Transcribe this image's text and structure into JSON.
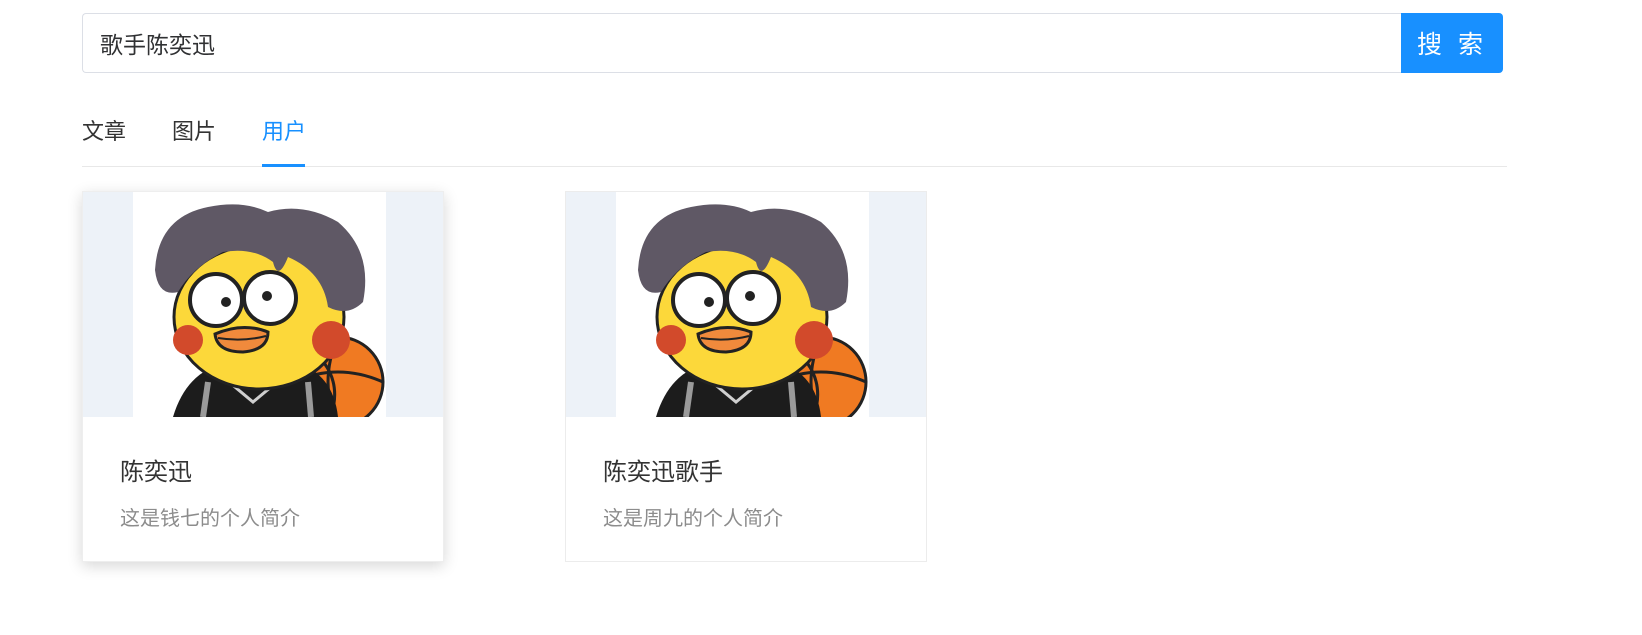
{
  "search": {
    "value": "歌手陈奕迅",
    "button_label": "搜 索"
  },
  "tabs": [
    {
      "label": "文章"
    },
    {
      "label": "图片"
    },
    {
      "label": "用户"
    }
  ],
  "active_tab": "用户",
  "users": [
    {
      "name": "陈奕迅",
      "bio": "这是钱七的个人简介",
      "avatar": "duck-with-hair-basketball-avatar"
    },
    {
      "name": "陈奕迅歌手",
      "bio": "这是周九的个人简介",
      "avatar": "duck-with-hair-basketball-avatar"
    }
  ],
  "colors": {
    "accent": "#1890ff",
    "cover_bg": "#edf2f8"
  }
}
